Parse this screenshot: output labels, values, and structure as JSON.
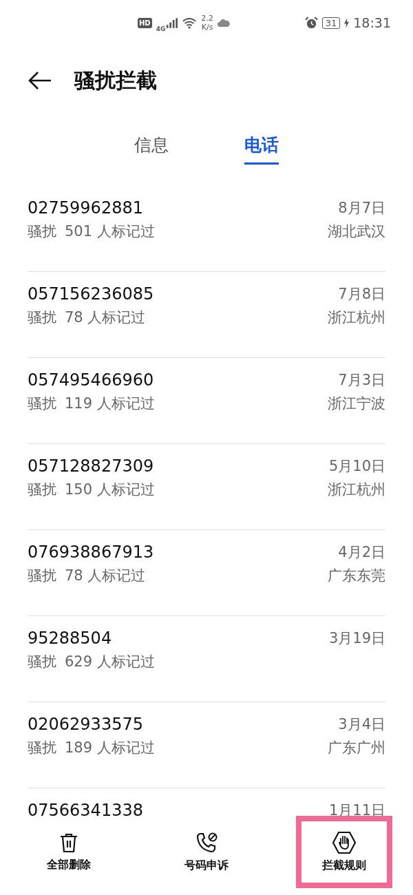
{
  "status_bar": {
    "hd": "HD",
    "network": "4G",
    "speed_value": "2.2",
    "speed_unit": "K/s",
    "battery": "31",
    "time": "18:31"
  },
  "header": {
    "title": "骚扰拦截"
  },
  "tabs": [
    {
      "label": "信息",
      "selected": false
    },
    {
      "label": "电话",
      "selected": true
    }
  ],
  "calls": [
    {
      "number": "02759962881",
      "tag": "骚扰",
      "count": "501 人标记过",
      "date": "8月7日",
      "location": "湖北武汉"
    },
    {
      "number": "057156236085",
      "tag": "骚扰",
      "count": "78 人标记过",
      "date": "7月8日",
      "location": "浙江杭州"
    },
    {
      "number": "057495466960",
      "tag": "骚扰",
      "count": "119 人标记过",
      "date": "7月3日",
      "location": "浙江宁波"
    },
    {
      "number": "057128827309",
      "tag": "骚扰",
      "count": "150 人标记过",
      "date": "5月10日",
      "location": "浙江杭州"
    },
    {
      "number": "076938867913",
      "tag": "骚扰",
      "count": "78 人标记过",
      "date": "4月2日",
      "location": "广东东莞"
    },
    {
      "number": "95288504",
      "tag": "骚扰",
      "count": "629 人标记过",
      "date": "3月19日"
    },
    {
      "number": "02062933575",
      "tag": "骚扰",
      "count": "189 人标记过",
      "date": "3月4日",
      "location": "广东广州"
    },
    {
      "number": "07566341338",
      "date": "1月11日"
    }
  ],
  "actions": [
    {
      "kind": "delete",
      "label": "全部删除",
      "highlighted": false
    },
    {
      "kind": "appeal",
      "label": "号码申诉",
      "highlighted": false
    },
    {
      "kind": "rules",
      "label": "拦截规则",
      "highlighted": true
    }
  ]
}
